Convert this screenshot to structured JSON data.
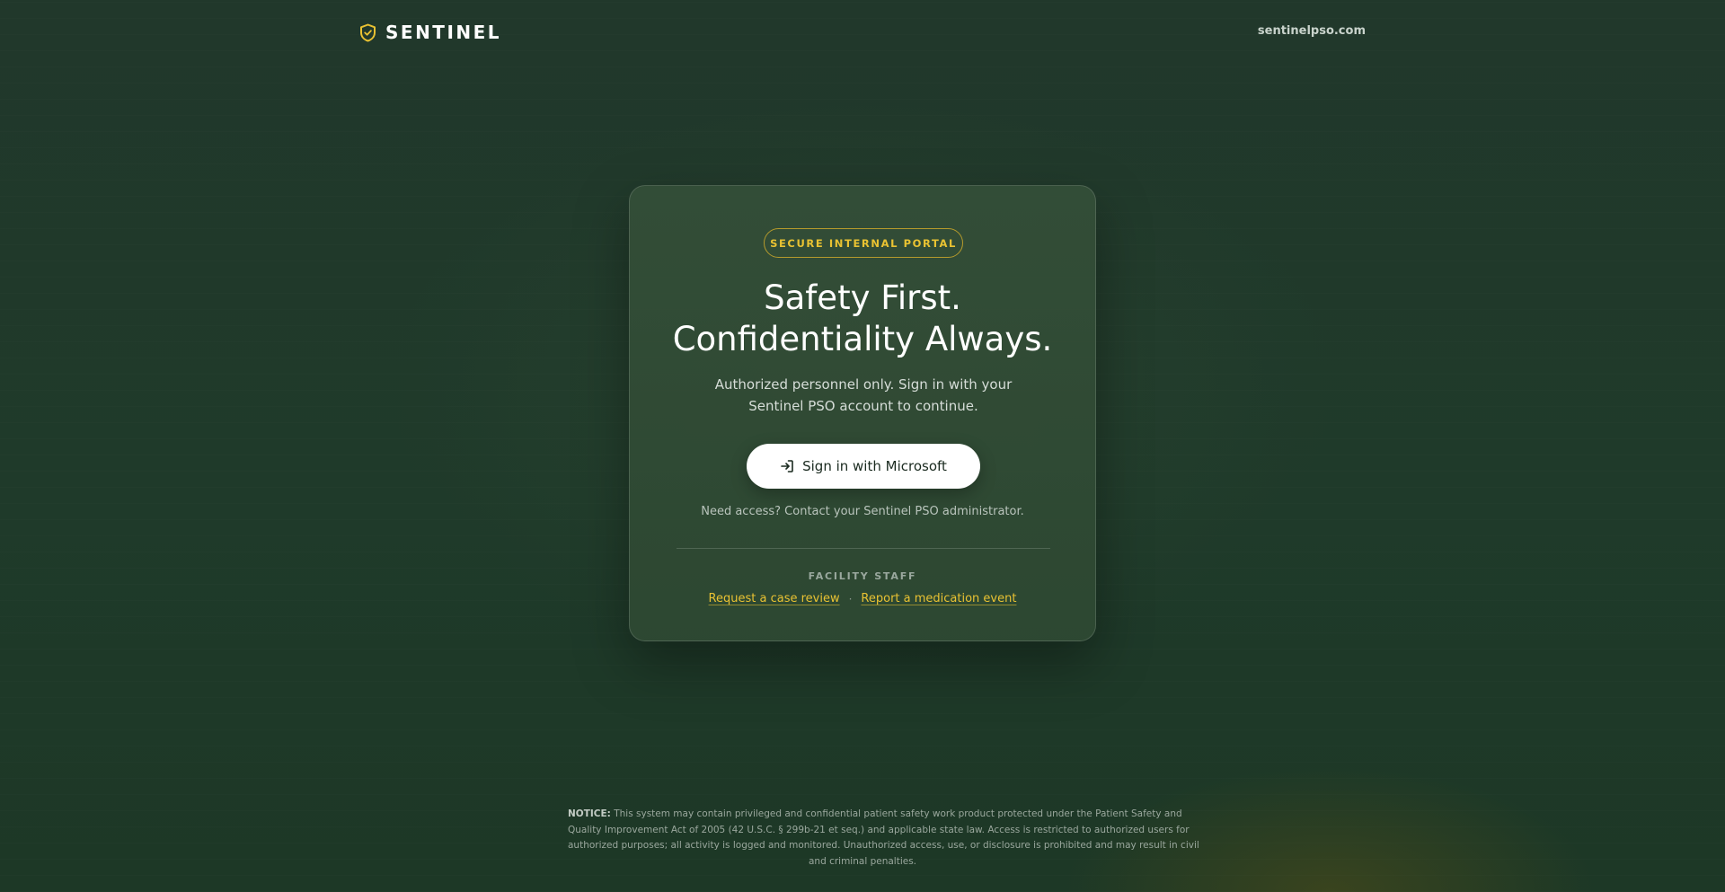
{
  "header": {
    "brand_name": "SENTINEL",
    "brand_icon": "shield-check-icon",
    "site_link": "sentinelpso.com"
  },
  "card": {
    "badge": "SECURE INTERNAL PORTAL",
    "headline_line1": "Safety First.",
    "headline_line2": "Confidentiality Always.",
    "subtitle_line1": "Authorized personnel only. Sign in with your",
    "subtitle_line2": "Sentinel PSO account to continue.",
    "signin_button": "Sign in with Microsoft",
    "signin_icon": "sign-in-arrow-icon",
    "help_text": "Need access? Contact your Sentinel PSO administrator.",
    "staff_label": "FACILITY STAFF",
    "links": [
      {
        "label": "Request a case review"
      },
      {
        "label": "Report a medication event"
      }
    ],
    "link_separator": "·"
  },
  "footer": {
    "notice_label": "NOTICE:",
    "notice_line1": "This system may contain privileged and confidential patient safety work product protected under the Patient Safety and",
    "notice_line2": "Quality Improvement Act of 2005 (42 U.S.C. § 299b-21 et seq.) and applicable state law. Access is restricted to authorized users for",
    "notice_line3": "authorized purposes; all activity is logged and monitored. Unauthorized access, use, or disclosure is prohibited and may result in civil",
    "notice_line4": "and criminal penalties."
  },
  "colors": {
    "background": "#1f3a2a",
    "card": "#2f4a33",
    "accent": "#e9c232",
    "button": "#ffffff"
  }
}
